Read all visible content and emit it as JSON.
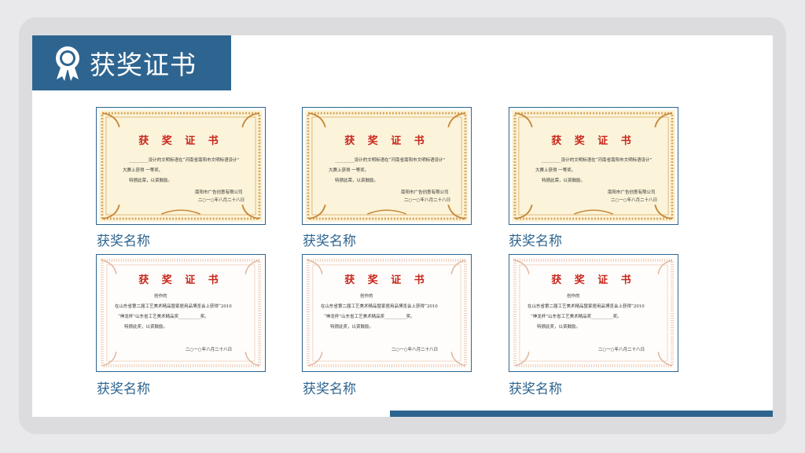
{
  "header": {
    "title": "获奖证书",
    "icon": "award-ribbon-icon"
  },
  "colors": {
    "accent": "#2e6590",
    "cert_red": "#c8261b"
  },
  "certificates": [
    {
      "caption": "获奖名称",
      "style": "gold",
      "title": "获 奖 证 书",
      "lines": [
        "_________设计的文明标语在“河南省南阳市文明标语设计”",
        "大赛上获得 一等奖。",
        "特颁此荣，以资鼓励。",
        "南阳市广告创意有限公司",
        "二○一○年八月二十八日"
      ]
    },
    {
      "caption": "获奖名称",
      "style": "gold",
      "title": "获 奖 证 书",
      "lines": [
        "_________设计的文明标语在“河南省南阳市文明标语设计”",
        "大赛上获得 一等奖。",
        "特颁此荣，以资鼓励。",
        "南阳市广告创意有限公司",
        "二○一○年八月二十八日"
      ]
    },
    {
      "caption": "获奖名称",
      "style": "gold",
      "title": "获 奖 证 书",
      "lines": [
        "_________设计的文明标语在“河南省南阳市文明标语设计”",
        "大赛上获得 一等奖。",
        "特颁此荣，以资鼓励。",
        "南阳市广告创意有限公司",
        "二○一○年八月二十八日"
      ]
    },
    {
      "caption": "获奖名称",
      "style": "white",
      "title": "获 奖 证 书",
      "lines": [
        "创作的",
        "在山东省第二届工艺美术精品暨家居用品博览会上获得“2010",
        "“神龙杯”山东省工艺美术精品奖__________奖。",
        "特颁此奖，以资鼓励。",
        "二○一○年八月二十八日"
      ]
    },
    {
      "caption": "获奖名称",
      "style": "white",
      "title": "获 奖 证 书",
      "lines": [
        "创作的",
        "在山东省第二届工艺美术精品暨家居用品博览会上获得“2010",
        "“神龙杯”山东省工艺美术精品奖__________奖。",
        "特颁此奖，以资鼓励。",
        "二○一○年八月二十八日"
      ]
    },
    {
      "caption": "获奖名称",
      "style": "white",
      "title": "获 奖 证 书",
      "lines": [
        "创作的",
        "在山东省第二届工艺美术精品暨家居用品博览会上获得“2010",
        "“神龙杯”山东省工艺美术精品奖__________奖。",
        "特颁此奖，以资鼓励。",
        "二○一○年八月二十八日"
      ]
    }
  ]
}
